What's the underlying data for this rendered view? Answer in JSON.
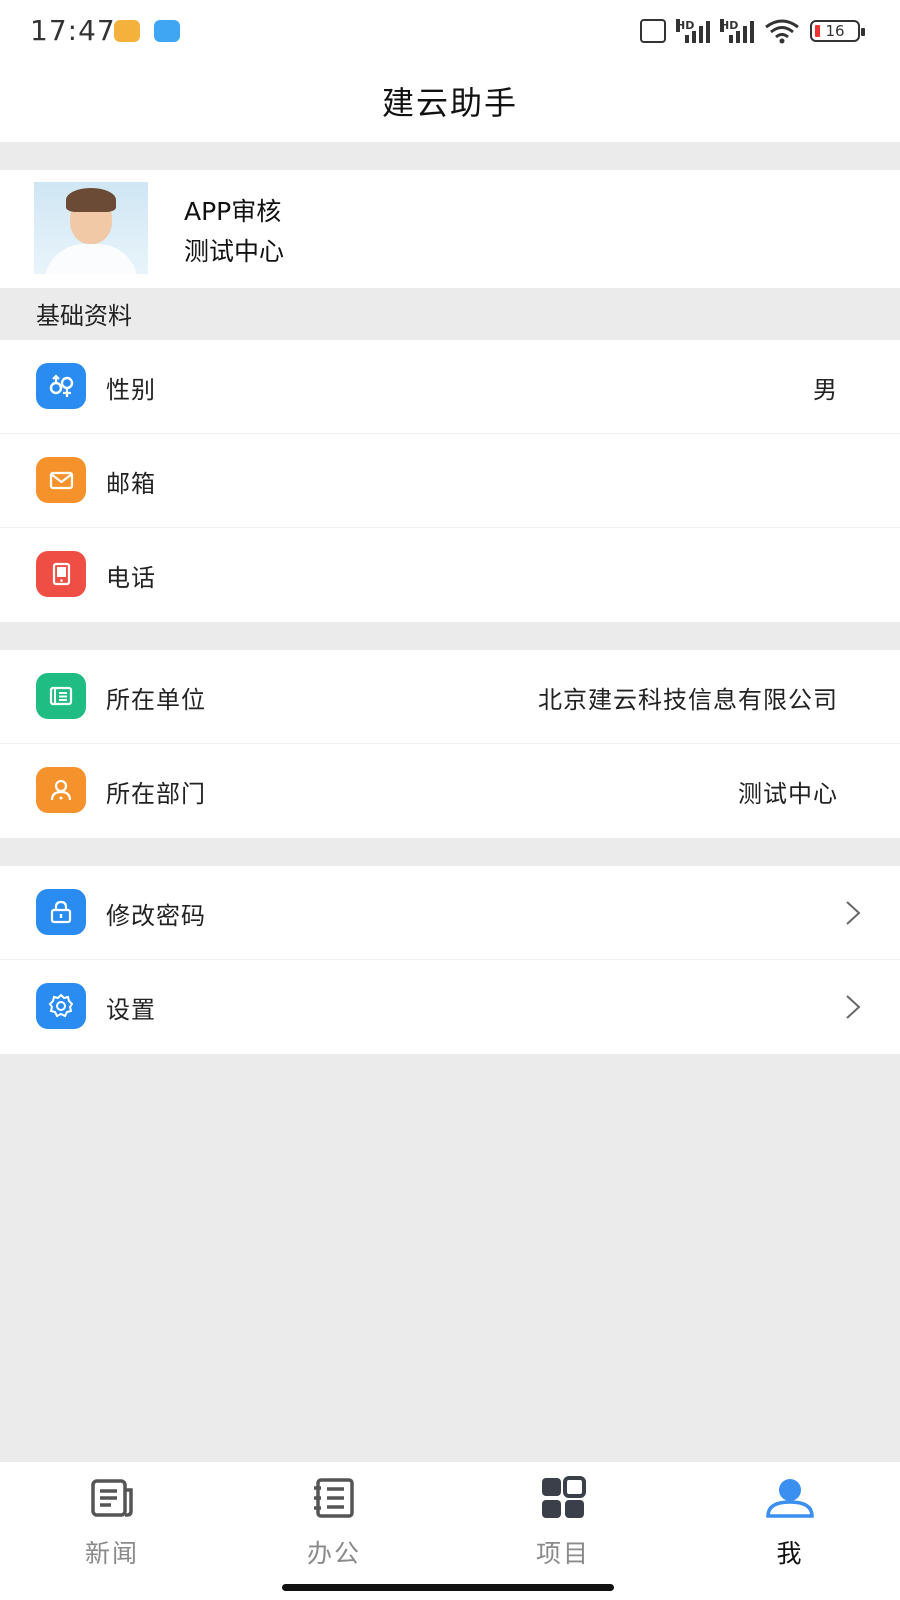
{
  "status_bar": {
    "time": "17:47",
    "hd1": "HD",
    "hd2": "HD",
    "battery_level": "16"
  },
  "header": {
    "title": "建云助手"
  },
  "profile": {
    "name": "APP审核",
    "department": "测试中心"
  },
  "basic_info": {
    "section_title": "基础资料",
    "items": [
      {
        "label": "性别",
        "value": "男",
        "icon": "gender-icon",
        "color": "#2a8cf0"
      },
      {
        "label": "邮箱",
        "value": "",
        "icon": "mail-icon",
        "color": "#f6922c"
      },
      {
        "label": "电话",
        "value": "",
        "icon": "phone-icon",
        "color": "#ee4e44"
      }
    ]
  },
  "org_info": {
    "items": [
      {
        "label": "所在单位",
        "value": "北京建云科技信息有限公司",
        "icon": "company-icon",
        "color": "#1fbd83"
      },
      {
        "label": "所在部门",
        "value": "测试中心",
        "icon": "department-icon",
        "color": "#f6922c"
      }
    ]
  },
  "actions": {
    "items": [
      {
        "label": "修改密码",
        "icon": "lock-icon",
        "color": "#2a8cf0"
      },
      {
        "label": "设置",
        "icon": "gear-icon",
        "color": "#2a8cf0"
      }
    ]
  },
  "tab_bar": {
    "tabs": [
      {
        "label": "新闻",
        "icon": "news-icon",
        "active": false
      },
      {
        "label": "办公",
        "icon": "office-icon",
        "active": false
      },
      {
        "label": "项目",
        "icon": "project-grid-icon",
        "active": false
      },
      {
        "label": "我",
        "icon": "user-icon",
        "active": true
      }
    ],
    "active_color": "#3b8ff0",
    "inactive_color": "#555555"
  }
}
